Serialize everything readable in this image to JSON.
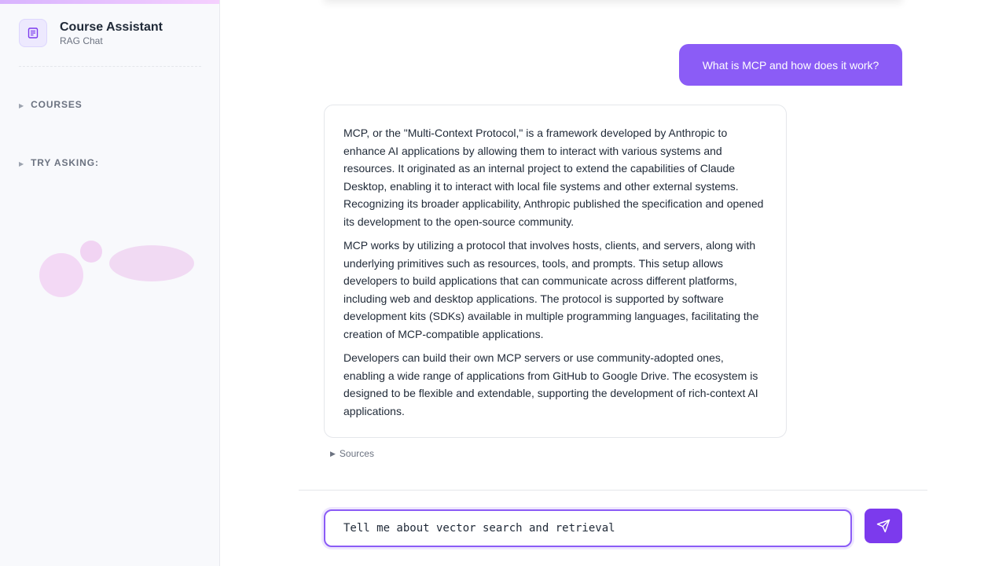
{
  "sidebar": {
    "title": "Course Assistant",
    "subtitle": "RAG Chat",
    "sections": [
      {
        "label": "Courses"
      },
      {
        "label": "Try asking:"
      }
    ]
  },
  "chat": {
    "user_message": "What is MCP and how does it work?",
    "assistant_paragraphs": [
      "MCP, or the \"Multi-Context Protocol,\" is a framework developed by Anthropic to enhance AI applications by allowing them to interact with various systems and resources. It originated as an internal project to extend the capabilities of Claude Desktop, enabling it to interact with local file systems and other external systems. Recognizing its broader applicability, Anthropic published the specification and opened its development to the open-source community.",
      "MCP works by utilizing a protocol that involves hosts, clients, and servers, along with underlying primitives such as resources, tools, and prompts. This setup allows developers to build applications that can communicate across different platforms, including web and desktop applications. The protocol is supported by software development kits (SDKs) available in multiple programming languages, facilitating the creation of MCP-compatible applications.",
      "Developers can build their own MCP servers or use community-adopted ones, enabling a wide range of applications from GitHub to Google Drive. The ecosystem is designed to be flexible and extendable, supporting the development of rich-context AI applications."
    ],
    "sources_label": "Sources"
  },
  "input": {
    "value": "Tell me about vector search and retrieval"
  },
  "icons": {
    "brand": "document-icon",
    "send": "send-icon",
    "expand": "triangle-right-icon"
  },
  "colors": {
    "accent": "#8b5cf6",
    "send_button": "#7c3aed",
    "sidebar_bg": "#f8f9fc"
  }
}
